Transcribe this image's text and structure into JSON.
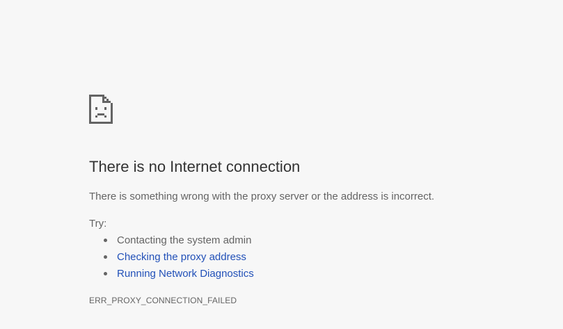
{
  "error_page": {
    "icon": "sad-page-icon",
    "headline": "There is no Internet connection",
    "description": "There is something wrong with the proxy server or the address is incorrect.",
    "try_label": "Try:",
    "suggestions": [
      {
        "text": "Contacting the system admin",
        "is_link": false
      },
      {
        "text": "Checking the proxy address",
        "is_link": true
      },
      {
        "text": "Running Network Diagnostics",
        "is_link": true
      }
    ],
    "error_code": "ERR_PROXY_CONNECTION_FAILED"
  },
  "colors": {
    "background": "#f7f7f7",
    "headline": "#333333",
    "body_text": "#646464",
    "link": "#2150b8"
  }
}
